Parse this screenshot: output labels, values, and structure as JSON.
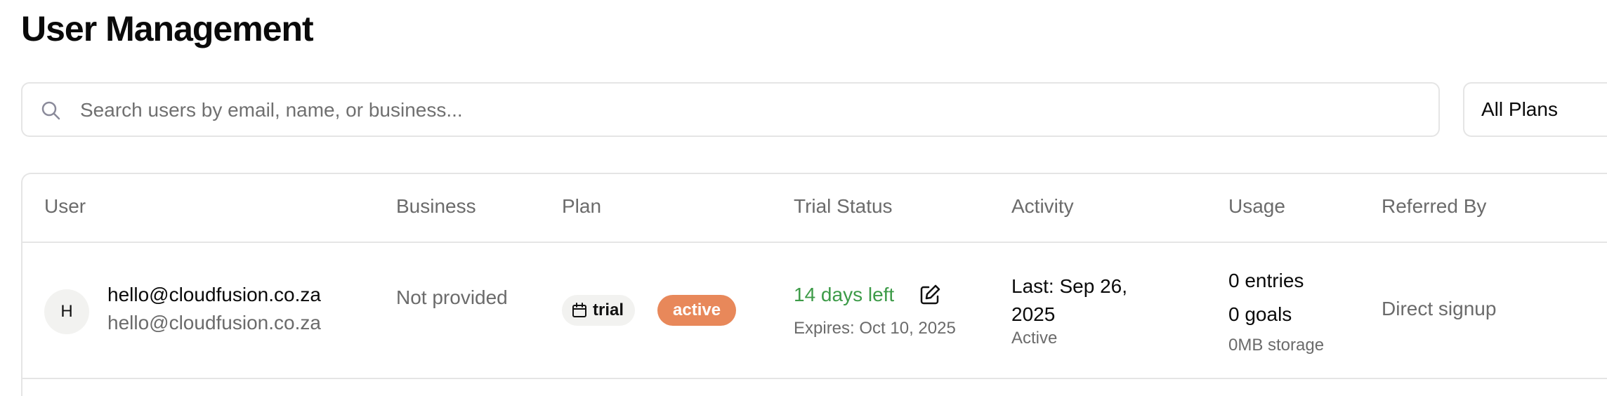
{
  "page": {
    "title": "User Management"
  },
  "search": {
    "placeholder": "Search users by email, name, or business...",
    "icon": "search-icon"
  },
  "filters": {
    "plan_selected": "All Plans"
  },
  "table": {
    "columns": [
      "User",
      "Business",
      "Plan",
      "Trial Status",
      "Activity",
      "Usage",
      "Referred By"
    ],
    "rows": [
      {
        "avatar_initial": "H",
        "user_primary": "hello@cloudfusion.co.za",
        "user_secondary": "hello@cloudfusion.co.za",
        "business": "Not provided",
        "plan": "trial",
        "plan_icon": "calendar-icon",
        "status": "active",
        "trial_days_left": "14 days left",
        "trial_expires": "Expires: Oct 10, 2025",
        "activity_last": "Last: Sep 26, 2025",
        "activity_status": "Active",
        "usage_entries": "0 entries",
        "usage_goals": "0 goals",
        "usage_storage": "0MB storage",
        "referred_by": "Direct signup"
      }
    ]
  },
  "colors": {
    "status_active": "#e8885a",
    "trial_days": "#3d9b48",
    "muted_text": "#6b6b6b",
    "border": "#e5e5e5"
  }
}
